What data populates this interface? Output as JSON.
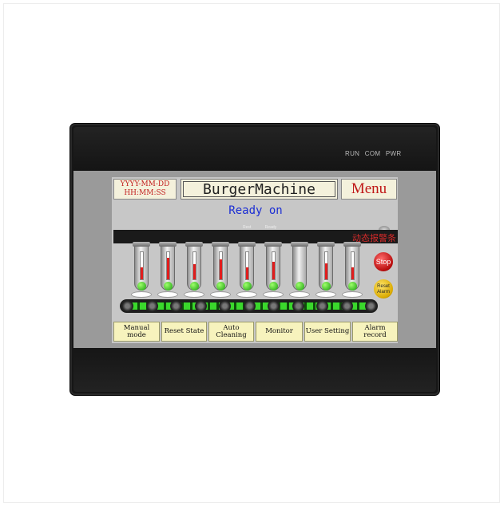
{
  "device": {
    "indicators": [
      "RUN",
      "COM",
      "PWR"
    ]
  },
  "header": {
    "date_placeholder": "YYYY-MM-DD",
    "time_placeholder": "HH:MM:SS",
    "title": "BurgerMachine",
    "menu_label": "Menu"
  },
  "status": {
    "text": "Ready on",
    "alarm_banner": "动态报警条",
    "small_labels": [
      "Rest",
      "Ready"
    ]
  },
  "tubes": {
    "count": 9,
    "fill_levels": [
      0.45,
      0.8,
      0.55,
      0.75,
      0.45,
      0.65,
      0.0,
      0.6,
      0.45
    ]
  },
  "controls": {
    "stop_label": "Stop",
    "reset_label_1": "Reset",
    "reset_label_2": "Alarm"
  },
  "nav": {
    "items": [
      "Manual mode",
      "Reset State",
      "Auto\nCleaning",
      "Monitor",
      "User Setting",
      "Alarm record"
    ]
  },
  "colors": {
    "accent_red": "#c01818",
    "status_blue": "#1c2fd4",
    "button_yellow": "#f7f3bd",
    "conveyor_green": "#3ad82c"
  }
}
